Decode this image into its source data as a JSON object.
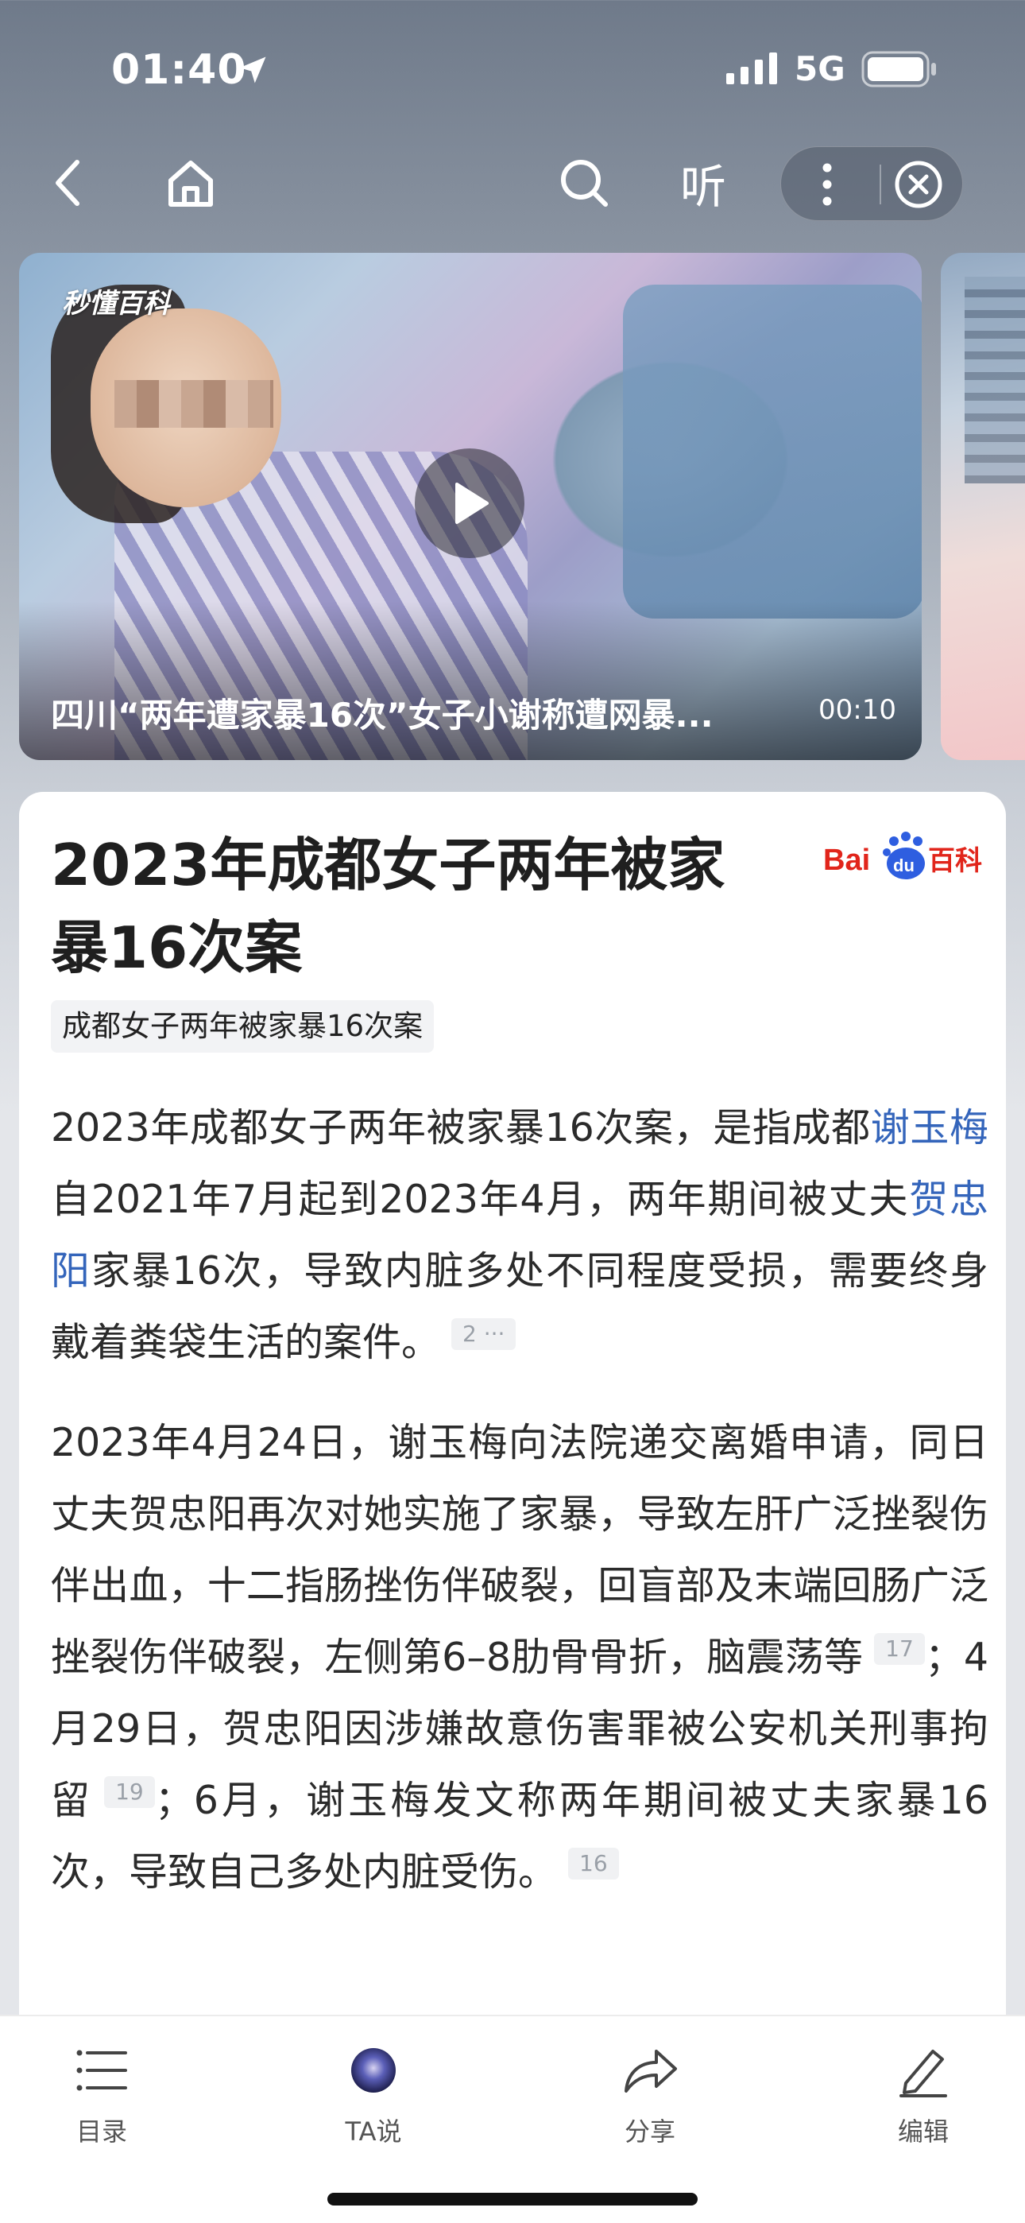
{
  "status_bar": {
    "time": "01:40",
    "network": "5G"
  },
  "nav": {
    "listen_label": "听"
  },
  "video": {
    "brand": "秒懂百科",
    "title": "四川“两年遭家暴16次”女子小谢称遭网暴...",
    "duration": "00:10"
  },
  "article": {
    "title": "2023年成都女子两年被家暴16次案",
    "logo_text": {
      "bai": "Bai",
      "du": "du",
      "baike": "百科"
    },
    "tag": "成都女子两年被家暴16次案",
    "p1": {
      "t1": "2023年成都女子两年被家暴16次案，是指成都",
      "link1": "谢玉梅",
      "t2": "自2021年7月起到2023年4月，两年期间被丈夫",
      "link2": "贺忠阳",
      "t3": "家暴16次，导致内脏多处不同程度受损，需要终身戴着粪袋生活的案件。",
      "ref1": "2 ···"
    },
    "p2": {
      "t1": "2023年4月24日，谢玉梅向法院递交离婚申请，同日丈夫贺忠阳再次对她实施了家暴，导致左肝广泛挫裂伤伴出血，十二指肠挫伤伴破裂，回盲部及末端回肠广泛挫裂伤伴破裂，左侧第6–8肋骨骨折，脑震荡等",
      "ref1": "17",
      "t2": "；4月29日，贺忠阳因涉嫌故意伤害罪被公安机关刑事拘留",
      "ref2": "19",
      "t3": "；6月，谢玉梅发文称两年期间被丈夫家暴16次，导致自己多处内脏受伤。",
      "ref3": "16"
    }
  },
  "toolbar": {
    "toc": "目录",
    "ta": "TA说",
    "share": "分享",
    "edit": "编辑"
  }
}
